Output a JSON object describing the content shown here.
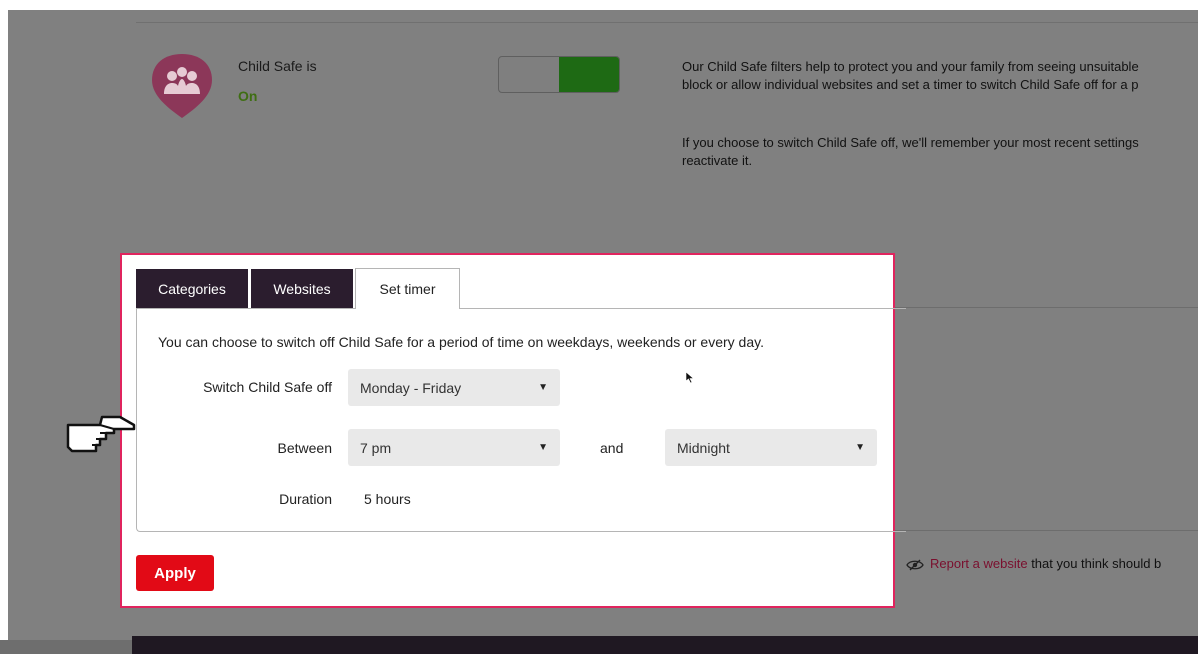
{
  "status": {
    "label": "Child Safe is",
    "value": "On",
    "toggle_on": true
  },
  "description": {
    "paragraph1_line1": "Our Child Safe filters help to protect you and your family from seeing unsuitable",
    "paragraph1_line2": "block or allow individual websites and set a timer to switch Child Safe off for a p",
    "paragraph2_line1": "If you choose to switch Child Safe off, we'll remember your most recent settings",
    "paragraph2_line2": "reactivate it."
  },
  "tabs": [
    {
      "label": "Categories",
      "active": false
    },
    {
      "label": "Websites",
      "active": false
    },
    {
      "label": "Set timer",
      "active": true
    }
  ],
  "timer": {
    "intro": "You can choose to switch off Child Safe for a period of time on weekdays, weekends or every day.",
    "switch_off_label": "Switch Child Safe off",
    "switch_off_value": "Monday - Friday",
    "between_label": "Between",
    "from_value": "7 pm",
    "and_label": "and",
    "to_value": "Midnight",
    "duration_label": "Duration",
    "duration_value": "5 hours"
  },
  "apply_label": "Apply",
  "report": {
    "link_text": "Report a website",
    "rest_text": "that you think should b"
  },
  "colors": {
    "accent": "#e20a16",
    "modal_border": "#e0245e",
    "tab_dark": "#2b1d2e",
    "on_green": "#3f6e13",
    "shield_pink": "#d2427f"
  },
  "icons": {
    "shield": "family-shield-icon",
    "caret": "caret-down-icon",
    "eye": "eye-slash-icon",
    "hand": "pointing-hand-cursor-icon",
    "cursor": "arrow-cursor-icon"
  }
}
